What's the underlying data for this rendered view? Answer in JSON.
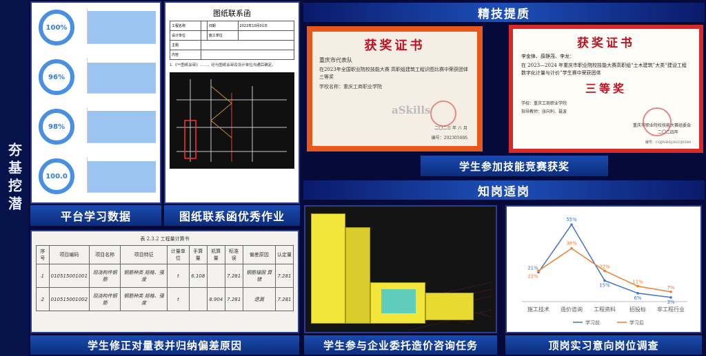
{
  "sidebar": {
    "title": "夯基挖潜"
  },
  "platform": {
    "caption": "平台学习数据",
    "items": [
      {
        "percent": "100%",
        "fill": 0.92
      },
      {
        "percent": "96%",
        "fill": 0.86
      },
      {
        "percent": "98%",
        "fill": 0.9
      },
      {
        "percent": "100.0",
        "fill": 0.88
      }
    ]
  },
  "letter": {
    "caption": "图纸联系函优秀作业",
    "doc_title": "图纸联系函",
    "rows": [
      [
        "工程名称",
        "",
        "日期",
        "2022年10月01日"
      ],
      [
        "设计单位",
        "",
        "施工单位",
        ""
      ],
      [
        "主题",
        "",
        "",
        ""
      ],
      [
        "内容",
        "",
        "",
        ""
      ]
    ],
    "para": "1.《**图纸会审》……，经与图纸会审及设计单位沟通后确定。"
  },
  "skills": {
    "header": "精技提质",
    "caption": "学生参加技能竞赛获奖",
    "cert1": {
      "title": "获奖证书",
      "team": "重庆市代表队",
      "body": "在2023年全国职业院校技能大赛 高职组建筑工程识图比赛中荣获团体 三等奖",
      "school": "学校名称：重庆工商职业学院",
      "watermark": "aSkills",
      "date": "二〇二三 年 八 月",
      "code": "编号：202305886"
    },
    "cert2": {
      "title": "获奖证书",
      "names": "李金锋、薛静茂、李龙：",
      "body": "在 2023—2024 年重庆市职业院校技能大赛高职组“土木建筑”大类“建设工程数字化计量与计价”学生赛中荣获团体",
      "prize": "三等奖",
      "school": "学校：重庆工商职业学院",
      "teacher": "指导教师：张向利、聂波",
      "org": "重庆市职业院校技能大赛组委会",
      "date": "二〇二四年",
      "code": "编号：CQJNDS[2023]0588"
    }
  },
  "post": {
    "header": "知岗适岗",
    "caption_left": "学生修正对量表并归纳偏差原因",
    "caption_mid": "学生参与企业委托造价咨询任务",
    "caption_right": "顶岗实习意向岗位调查"
  },
  "sheet": {
    "title": "表 2.3.2 工程量计算书",
    "headers": [
      "序号",
      "项目编码",
      "项目名称",
      "项目特征",
      "计量单位",
      "手算量",
      "机算量",
      "标准误",
      "偏差原因",
      "认定量"
    ],
    "rows": [
      [
        "1",
        "010515001001",
        "现浇构件钢筋",
        "钢筋种类 规格、强度",
        "t",
        "6.108",
        "",
        "7.281",
        "钢筋锚固 算错",
        "7.281"
      ],
      [
        "2",
        "010515001002",
        "现浇构件钢筋",
        "钢筋种类 规格、强度",
        "t",
        "",
        "8.904",
        "7.281",
        "遗漏",
        "7.281"
      ]
    ]
  },
  "chart_data": {
    "type": "line",
    "categories": [
      "施工技术",
      "造价咨询",
      "工程资料",
      "招投标",
      "非工程行业"
    ],
    "series": [
      {
        "name": "学习前",
        "values": [
          21,
          55,
          15,
          6,
          3
        ],
        "labels": [
          "21%",
          "55%",
          "15%",
          "6%",
          "3%"
        ],
        "color": "#4472c4"
      },
      {
        "name": "学习后",
        "values": [
          22,
          38,
          22,
          11,
          7
        ],
        "labels": [
          "22%",
          "38%",
          "22%",
          "11%",
          "7%"
        ],
        "color": "#ed7d31"
      }
    ],
    "ylim": [
      0,
      60
    ],
    "legend": "bottom"
  }
}
